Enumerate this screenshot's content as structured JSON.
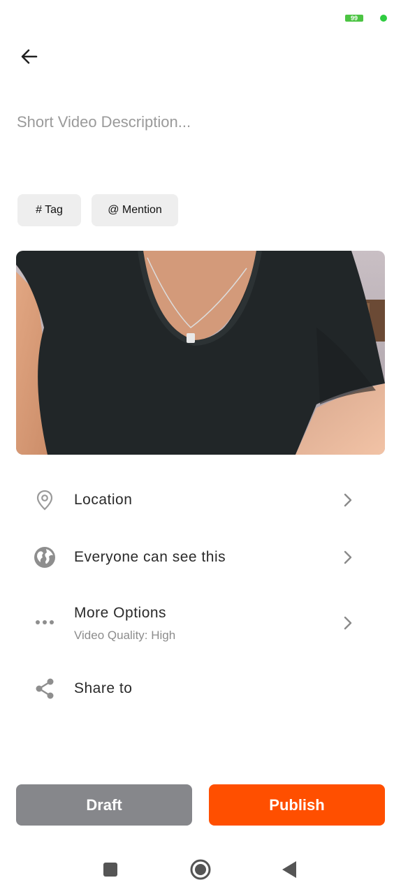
{
  "status_bar": {
    "battery_level": "99",
    "battery_color": "#4cc443",
    "dot_color": "#2ecc40"
  },
  "header": {
    "back_icon": "arrow-left-icon"
  },
  "description": {
    "placeholder": "Short Video Description...",
    "value": ""
  },
  "chips": {
    "tag_label": "# Tag",
    "mention_label": "@ Mention"
  },
  "options": {
    "location": {
      "label": "Location",
      "icon": "location-pin-icon"
    },
    "visibility": {
      "label": "Everyone can see this",
      "icon": "globe-icon"
    },
    "more": {
      "label": "More Options",
      "sublabel": "Video Quality: High",
      "icon": "more-horizontal-icon"
    },
    "share": {
      "label": "Share to",
      "icon": "share-icon"
    }
  },
  "actions": {
    "draft_label": "Draft",
    "publish_label": "Publish",
    "publish_color": "#ff4f00",
    "draft_color": "#86878b"
  },
  "nav": {
    "recents_icon": "square-icon",
    "home_icon": "circle-icon",
    "back_icon": "triangle-back-icon"
  }
}
